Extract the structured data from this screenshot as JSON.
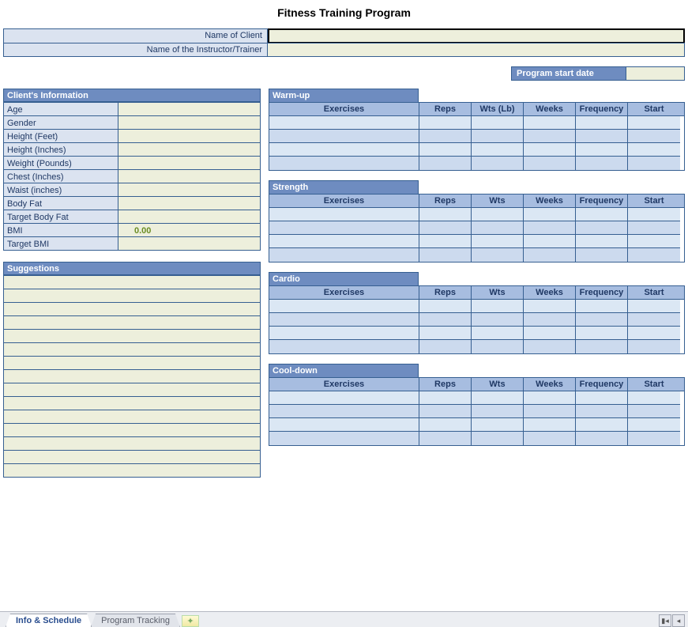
{
  "title": "Fitness Training Program",
  "header": {
    "client_label": "Name of Client",
    "client_value": "",
    "trainer_label": "Name of the Instructor/Trainer",
    "trainer_value": ""
  },
  "program_start": {
    "label": "Program start date",
    "value": ""
  },
  "client_info": {
    "title": "Client's Information",
    "rows": [
      {
        "label": "Age",
        "value": ""
      },
      {
        "label": "Gender",
        "value": ""
      },
      {
        "label": "Height (Feet)",
        "value": ""
      },
      {
        "label": "Height (Inches)",
        "value": ""
      },
      {
        "label": "Weight (Pounds)",
        "value": ""
      },
      {
        "label": "Chest (Inches)",
        "value": ""
      },
      {
        "label": "Waist (inches)",
        "value": ""
      },
      {
        "label": "Body Fat",
        "value": ""
      },
      {
        "label": "Target Body Fat",
        "value": ""
      },
      {
        "label": "BMI",
        "value": "0.00",
        "calc": true
      },
      {
        "label": "Target BMI",
        "value": ""
      }
    ]
  },
  "suggestions": {
    "title": "Suggestions",
    "row_count": 15
  },
  "workouts": [
    {
      "title": "Warm-up",
      "columns": [
        "Exercises",
        "Reps",
        "Wts (Lb)",
        "Weeks",
        "Frequency",
        "Start"
      ],
      "row_count": 4
    },
    {
      "title": "Strength",
      "columns": [
        "Exercises",
        "Reps",
        "Wts",
        "Weeks",
        "Frequency",
        "Start"
      ],
      "row_count": 4
    },
    {
      "title": "Cardio",
      "columns": [
        "Exercises",
        "Reps",
        "Wts",
        "Weeks",
        "Frequency",
        "Start"
      ],
      "row_count": 4
    },
    {
      "title": "Cool-down",
      "columns": [
        "Exercises",
        "Reps",
        "Wts",
        "Weeks",
        "Frequency",
        "Start"
      ],
      "row_count": 4
    }
  ],
  "tabs": {
    "active": "Info & Schedule",
    "other": "Program Tracking"
  }
}
